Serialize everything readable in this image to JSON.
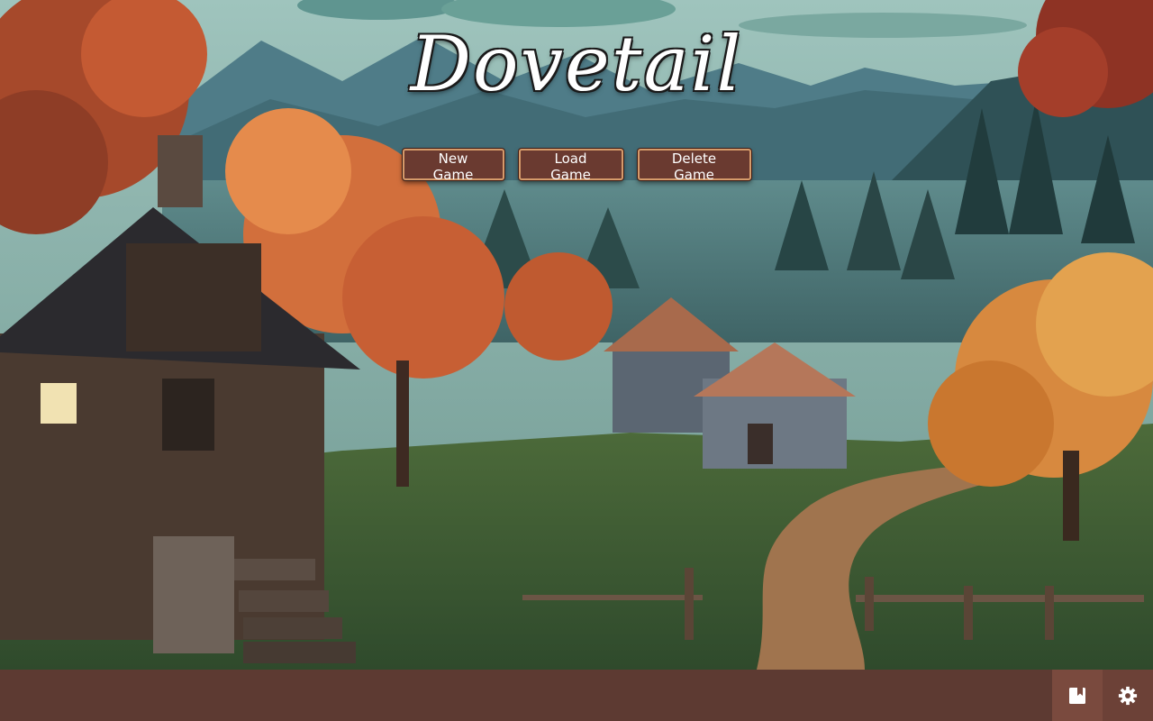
{
  "game": {
    "title": "Dovetail"
  },
  "menu": {
    "new_game": "New Game",
    "load_game": "Load Game",
    "delete_game": "Delete Game"
  },
  "toolbar": {
    "save_icon": "save-book-icon",
    "settings_icon": "gear-icon"
  },
  "colors": {
    "bar": "#5d3a32",
    "button_fill": "#6a3a30",
    "button_border": "#d59a6a"
  }
}
